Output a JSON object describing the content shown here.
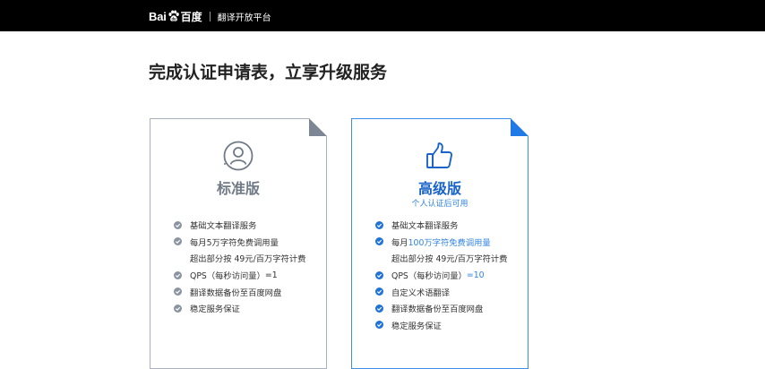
{
  "header": {
    "logo_left": "Bai",
    "logo_right": "百度",
    "subtitle": "翻译开放平台"
  },
  "page": {
    "title": "完成认证申请表，立享升级服务"
  },
  "colors": {
    "topbar": "#000000",
    "accent_blue": "#2f83e2",
    "standard_gray": "#707a87",
    "standard_border": "#a9b1bf",
    "pro_border": "#3d8ee8"
  },
  "plans": {
    "standard": {
      "name": "标准版",
      "icon": "user-circle-icon",
      "features": {
        "f1": "基础文本翻译服务",
        "f2_pre": "每月",
        "f2_hl": "5万字符免费调用量",
        "f3": "超出部分按 49元/百万字符计费",
        "f4_pre": "QPS（每秒访问量）",
        "f4_hl": "=1",
        "f5": "翻译数据备份至百度网盘",
        "f6": "稳定服务保证"
      }
    },
    "premium": {
      "name": "高级版",
      "subtitle": "个人认证后可用",
      "icon": "thumbs-up-icon",
      "features": {
        "f1": "基础文本翻译服务",
        "f2_pre": "每月",
        "f2_hl": "100万字符免费调用量",
        "f3": "超出部分按 49元/百万字符计费",
        "f4_pre": "QPS（每秒访问量）",
        "f4_hl": "=10",
        "f5": "自定义术语翻译",
        "f6": "翻译数据备份至百度网盘",
        "f7": "稳定服务保证"
      }
    }
  }
}
